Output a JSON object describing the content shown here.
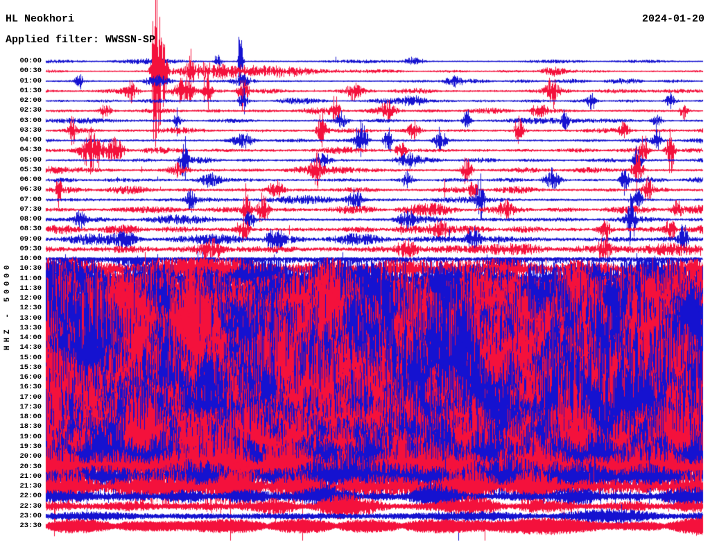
{
  "header": {
    "station": "HL Neokhori",
    "filter_line": "Applied filter: WWSSN-SP",
    "date": "2024-01-20"
  },
  "chart_data": {
    "type": "line",
    "variant": "helicorder-day-plot",
    "title": "HL Neokhori",
    "date": "2024-01-20",
    "filter": "WWSSN-SP",
    "channel": "HHZ",
    "amplitude_scale": 50000,
    "y_axis_label": "HHZ - 50000",
    "minutes_per_row": 30,
    "background": "#ffffff",
    "trace_colors": {
      "even_rows": "#1512d0",
      "odd_rows": "#f4113c"
    },
    "legend": "rows alternate blue (on the hour) and red (on the half hour); amplitudes in pixels at 1x; events are [position_fraction, amplitude, width_fraction]",
    "rows": [
      {
        "t": "00:00",
        "color": "blue",
        "amp": 3.0,
        "events": [
          [
            0.296,
            80,
            0.0022
          ],
          [
            0.262,
            14,
            0.004
          ],
          [
            0.56,
            7,
            0.01
          ]
        ]
      },
      {
        "t": "00:30",
        "color": "red",
        "amp": 3.0,
        "events": [
          [
            0.166,
            190,
            0.0035
          ],
          [
            0.172,
            90,
            0.004
          ],
          [
            0.178,
            70,
            0.004
          ],
          [
            0.22,
            55,
            0.0025
          ],
          [
            0.25,
            12,
            0.04
          ],
          [
            0.35,
            8,
            0.05
          ],
          [
            0.77,
            9,
            0.012
          ]
        ]
      },
      {
        "t": "01:00",
        "color": "blue",
        "amp": 3.6,
        "events": [
          [
            0.05,
            14,
            0.004
          ],
          [
            0.17,
            12,
            0.012
          ],
          [
            0.3,
            10,
            0.01
          ],
          [
            0.62,
            8,
            0.01
          ]
        ]
      },
      {
        "t": "01:30",
        "color": "red",
        "amp": 4.5,
        "events": [
          [
            0.13,
            18,
            0.006
          ],
          [
            0.21,
            26,
            0.01
          ],
          [
            0.245,
            40,
            0.004
          ],
          [
            0.3,
            34,
            0.005
          ],
          [
            0.47,
            14,
            0.008
          ],
          [
            0.77,
            28,
            0.006
          ]
        ]
      },
      {
        "t": "02:00",
        "color": "blue",
        "amp": 3.8,
        "events": [
          [
            0.3,
            24,
            0.004
          ],
          [
            0.56,
            10,
            0.012
          ],
          [
            0.83,
            18,
            0.004
          ],
          [
            0.95,
            12,
            0.005
          ]
        ]
      },
      {
        "t": "02:30",
        "color": "red",
        "amp": 4.6,
        "events": [
          [
            0.09,
            12,
            0.006
          ],
          [
            0.44,
            26,
            0.004
          ],
          [
            0.52,
            14,
            0.008
          ],
          [
            0.75,
            12,
            0.008
          ],
          [
            0.97,
            18,
            0.004
          ]
        ]
      },
      {
        "t": "03:00",
        "color": "blue",
        "amp": 4.2,
        "events": [
          [
            0.2,
            26,
            0.003
          ],
          [
            0.45,
            14,
            0.006
          ],
          [
            0.64,
            20,
            0.004
          ],
          [
            0.79,
            16,
            0.004
          ],
          [
            0.93,
            12,
            0.005
          ]
        ]
      },
      {
        "t": "03:30",
        "color": "red",
        "amp": 5.0,
        "events": [
          [
            0.04,
            20,
            0.004
          ],
          [
            0.42,
            28,
            0.005
          ],
          [
            0.56,
            16,
            0.006
          ],
          [
            0.72,
            24,
            0.005
          ],
          [
            0.88,
            14,
            0.005
          ]
        ]
      },
      {
        "t": "04:00",
        "color": "blue",
        "amp": 4.5,
        "events": [
          [
            0.3,
            12,
            0.01
          ],
          [
            0.48,
            36,
            0.006
          ],
          [
            0.52,
            28,
            0.004
          ],
          [
            0.6,
            20,
            0.006
          ],
          [
            0.93,
            18,
            0.004
          ]
        ]
      },
      {
        "t": "04:30",
        "color": "red",
        "amp": 5.2,
        "events": [
          [
            0.07,
            38,
            0.01
          ],
          [
            0.105,
            28,
            0.008
          ],
          [
            0.54,
            18,
            0.005
          ],
          [
            0.91,
            26,
            0.004
          ],
          [
            0.95,
            44,
            0.004
          ]
        ]
      },
      {
        "t": "05:00",
        "color": "blue",
        "amp": 4.6,
        "events": [
          [
            0.21,
            40,
            0.004
          ],
          [
            0.42,
            14,
            0.008
          ],
          [
            0.55,
            12,
            0.012
          ],
          [
            0.9,
            28,
            0.004
          ]
        ]
      },
      {
        "t": "05:30",
        "color": "red",
        "amp": 5.4,
        "events": [
          [
            0.2,
            12,
            0.01
          ],
          [
            0.41,
            30,
            0.004
          ],
          [
            0.64,
            24,
            0.005
          ],
          [
            0.9,
            38,
            0.005
          ]
        ]
      },
      {
        "t": "06:00",
        "color": "blue",
        "amp": 4.8,
        "sp": 0.002,
        "sm": 3,
        "events": [
          [
            0.25,
            12,
            0.012
          ],
          [
            0.55,
            20,
            0.004
          ],
          [
            0.77,
            18,
            0.008
          ],
          [
            0.88,
            32,
            0.004
          ]
        ]
      },
      {
        "t": "06:30",
        "color": "red",
        "amp": 5.6,
        "sp": 0.002,
        "sm": 3,
        "events": [
          [
            0.02,
            26,
            0.003
          ],
          [
            0.35,
            14,
            0.008
          ],
          [
            0.65,
            18,
            0.004
          ],
          [
            0.915,
            24,
            0.005
          ]
        ]
      },
      {
        "t": "07:00",
        "color": "blue",
        "amp": 5.4,
        "sp": 0.002,
        "sm": 3,
        "events": [
          [
            0.22,
            26,
            0.004
          ],
          [
            0.47,
            16,
            0.008
          ],
          [
            0.66,
            36,
            0.004
          ],
          [
            0.9,
            18,
            0.005
          ]
        ]
      },
      {
        "t": "07:30",
        "color": "red",
        "amp": 6.2,
        "sp": 0.002,
        "sm": 3,
        "events": [
          [
            0.305,
            48,
            0.004
          ],
          [
            0.33,
            28,
            0.006
          ],
          [
            0.7,
            16,
            0.006
          ],
          [
            0.96,
            22,
            0.005
          ]
        ]
      },
      {
        "t": "08:00",
        "color": "blue",
        "amp": 5.6,
        "sp": 0.002,
        "sm": 3,
        "events": [
          [
            0.05,
            16,
            0.006
          ],
          [
            0.31,
            18,
            0.005
          ],
          [
            0.55,
            14,
            0.008
          ],
          [
            0.89,
            46,
            0.004
          ]
        ]
      },
      {
        "t": "08:30",
        "color": "red",
        "amp": 7.4,
        "sp": 0.0025,
        "sm": 3,
        "events": [
          [
            0.3,
            24,
            0.006
          ],
          [
            0.6,
            16,
            0.01
          ],
          [
            0.85,
            18,
            0.006
          ],
          [
            0.95,
            22,
            0.005
          ]
        ]
      },
      {
        "t": "09:00",
        "color": "blue",
        "amp": 8.4,
        "sp": 0.0025,
        "sm": 3,
        "events": [
          [
            0.12,
            14,
            0.01
          ],
          [
            0.35,
            18,
            0.01
          ],
          [
            0.65,
            22,
            0.006
          ],
          [
            0.97,
            26,
            0.004
          ]
        ]
      },
      {
        "t": "09:30",
        "color": "red",
        "amp": 9.6,
        "sp": 0.0025,
        "sm": 3,
        "events": [
          [
            0.25,
            20,
            0.01
          ],
          [
            0.55,
            18,
            0.01
          ],
          [
            0.85,
            22,
            0.006
          ]
        ]
      },
      {
        "t": "10:00",
        "color": "blue",
        "amp": 14,
        "sp": 0.003,
        "sm": 5,
        "events": [
          [
            0.3,
            40,
            0.01
          ],
          [
            0.7,
            45,
            0.012
          ]
        ]
      },
      {
        "t": "10:30",
        "color": "red",
        "amp": 22,
        "sp": 0.004,
        "sm": 5,
        "events": []
      },
      {
        "t": "11:00",
        "color": "blue",
        "amp": 34,
        "sp": 0.004,
        "sm": 4,
        "events": []
      },
      {
        "t": "11:30",
        "color": "red",
        "amp": 46,
        "sp": 0.004,
        "sm": 3.5,
        "events": []
      },
      {
        "t": "12:00",
        "color": "blue",
        "amp": 58,
        "sp": 0.004,
        "sm": 3,
        "events": []
      },
      {
        "t": "12:30",
        "color": "red",
        "amp": 68,
        "sp": 0.004,
        "sm": 2.8,
        "events": []
      },
      {
        "t": "13:00",
        "color": "blue",
        "amp": 78,
        "sp": 0.004,
        "sm": 2.6,
        "events": []
      },
      {
        "t": "13:30",
        "color": "red",
        "amp": 88,
        "sp": 0.004,
        "sm": 2.4,
        "events": []
      },
      {
        "t": "14:00",
        "color": "blue",
        "amp": 96,
        "sp": 0.004,
        "sm": 2.2,
        "events": []
      },
      {
        "t": "14:30",
        "color": "red",
        "amp": 103,
        "sp": 0.004,
        "sm": 2,
        "events": []
      },
      {
        "t": "15:00",
        "color": "blue",
        "amp": 108,
        "sp": 0.004,
        "sm": 2,
        "events": []
      },
      {
        "t": "15:30",
        "color": "red",
        "amp": 112,
        "sp": 0.004,
        "sm": 2,
        "events": []
      },
      {
        "t": "16:00",
        "color": "blue",
        "amp": 110,
        "sp": 0.004,
        "sm": 2,
        "events": []
      },
      {
        "t": "16:30",
        "color": "red",
        "amp": 106,
        "sp": 0.004,
        "sm": 2,
        "events": []
      },
      {
        "t": "17:00",
        "color": "blue",
        "amp": 111,
        "sp": 0.004,
        "sm": 2,
        "events": []
      },
      {
        "t": "17:30",
        "color": "red",
        "amp": 107,
        "sp": 0.004,
        "sm": 2,
        "events": []
      },
      {
        "t": "18:00",
        "color": "blue",
        "amp": 100,
        "sp": 0.004,
        "sm": 2,
        "events": []
      },
      {
        "t": "18:30",
        "color": "red",
        "amp": 95,
        "sp": 0.004,
        "sm": 2,
        "events": []
      },
      {
        "t": "19:00",
        "color": "blue",
        "amp": 90,
        "sp": 0.004,
        "sm": 2,
        "events": []
      },
      {
        "t": "19:30",
        "color": "red",
        "amp": 82,
        "sp": 0.004,
        "sm": 2,
        "events": []
      },
      {
        "t": "20:00",
        "color": "blue",
        "amp": 60,
        "sp": 0.004,
        "sm": 2,
        "events": []
      },
      {
        "t": "20:30",
        "color": "red",
        "amp": 48,
        "sp": 0.003,
        "sm": 2,
        "events": []
      },
      {
        "t": "21:00",
        "color": "blue",
        "amp": 32,
        "sp": 0.003,
        "sm": 2,
        "events": []
      },
      {
        "t": "21:30",
        "color": "red",
        "amp": 24,
        "sp": 0.003,
        "sm": 2,
        "events": []
      },
      {
        "t": "22:00",
        "color": "blue",
        "amp": 16,
        "u0": 0.35,
        "events": []
      },
      {
        "t": "22:30",
        "color": "red",
        "amp": 14,
        "u0": 0.35,
        "events": []
      },
      {
        "t": "23:00",
        "color": "blue",
        "amp": 13,
        "u0": 0.4,
        "events": []
      },
      {
        "t": "23:30",
        "color": "red",
        "amp": 11,
        "u0": 0.6,
        "shape": 0.6,
        "events": []
      }
    ]
  }
}
